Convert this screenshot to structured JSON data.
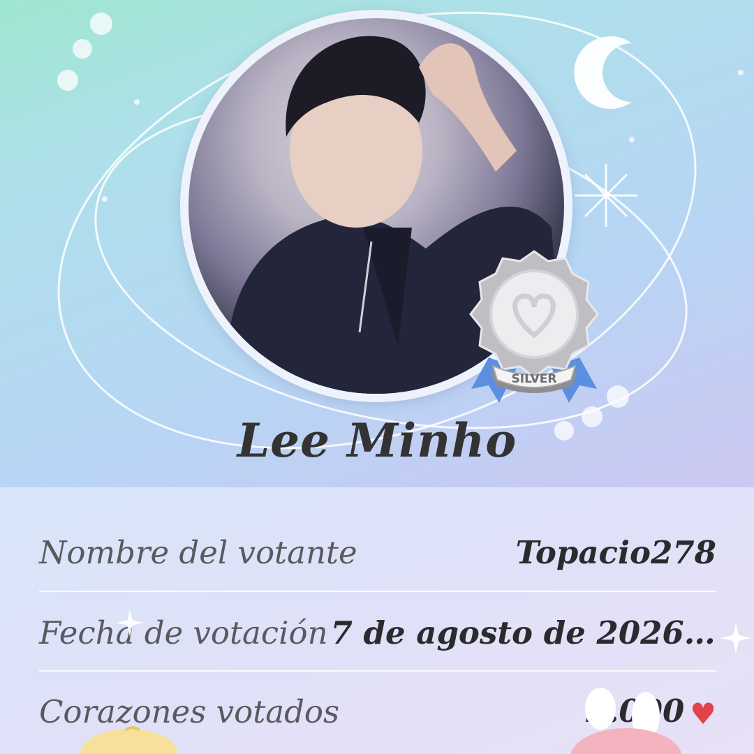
{
  "profile": {
    "name": "Lee Minho",
    "badge_label": "SILVER"
  },
  "details": {
    "voter_label": "Nombre del votante",
    "voter_value": "Topacio278",
    "date_label": "Fecha de votación",
    "date_value": "7 de agosto de 2026 ...",
    "hearts_label": "Corazones votados",
    "hearts_value": "2.000"
  },
  "icons": {
    "heart": "heart-icon",
    "moon": "crescent-moon-icon",
    "badge": "silver-medal-icon"
  },
  "colors": {
    "heart": "#e4414b",
    "ribbon": "#5b8fe0",
    "medal": "#c9c9cc"
  }
}
